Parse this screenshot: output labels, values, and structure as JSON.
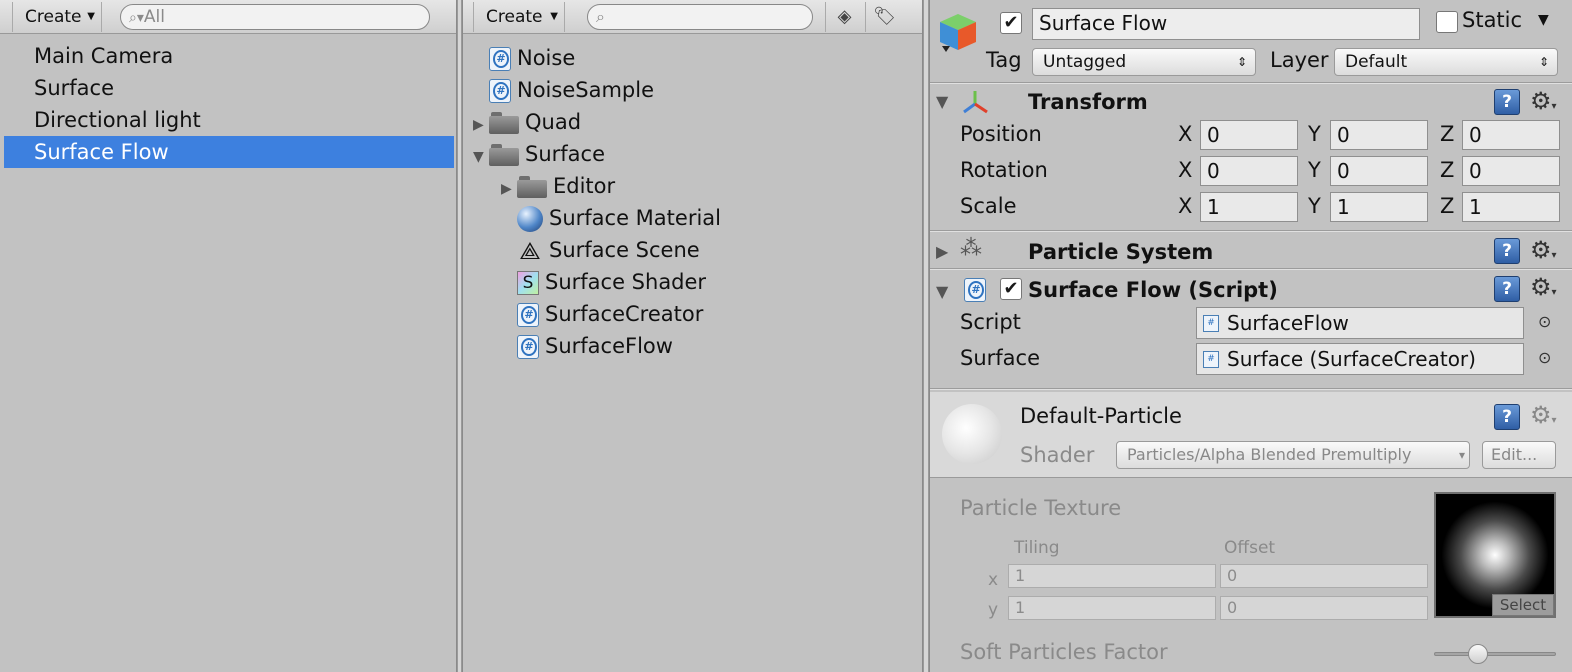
{
  "hierarchy": {
    "create_label": "Create",
    "search_placeholder": "All",
    "items": [
      {
        "label": "Main Camera",
        "selected": false
      },
      {
        "label": "Surface",
        "selected": false
      },
      {
        "label": "Directional light",
        "selected": false
      },
      {
        "label": "Surface Flow",
        "selected": true
      }
    ]
  },
  "project": {
    "create_label": "Create",
    "search_placeholder": "",
    "items": [
      {
        "label": "Noise",
        "icon": "csharp-script-icon",
        "depth": 0,
        "fold": ""
      },
      {
        "label": "NoiseSample",
        "icon": "csharp-script-icon",
        "depth": 0,
        "fold": ""
      },
      {
        "label": "Quad",
        "icon": "folder-icon",
        "depth": 0,
        "fold": "collapsed"
      },
      {
        "label": "Surface",
        "icon": "folder-icon",
        "depth": 0,
        "fold": "expanded"
      },
      {
        "label": "Editor",
        "icon": "folder-icon",
        "depth": 1,
        "fold": "collapsed"
      },
      {
        "label": "Surface Material",
        "icon": "material-icon",
        "depth": 1,
        "fold": ""
      },
      {
        "label": "Surface Scene",
        "icon": "unity-scene-icon",
        "depth": 1,
        "fold": ""
      },
      {
        "label": "Surface Shader",
        "icon": "shader-icon",
        "depth": 1,
        "fold": ""
      },
      {
        "label": "SurfaceCreator",
        "icon": "csharp-script-icon",
        "depth": 1,
        "fold": ""
      },
      {
        "label": "SurfaceFlow",
        "icon": "csharp-script-icon",
        "depth": 1,
        "fold": ""
      }
    ]
  },
  "inspector": {
    "object_name": "Surface Flow",
    "active": true,
    "static_label": "Static",
    "static_checked": false,
    "tag_label": "Tag",
    "tag_value": "Untagged",
    "layer_label": "Layer",
    "layer_value": "Default",
    "transform": {
      "title": "Transform",
      "rows": [
        {
          "label": "Position",
          "x": "0",
          "y": "0",
          "z": "0"
        },
        {
          "label": "Rotation",
          "x": "0",
          "y": "0",
          "z": "0"
        },
        {
          "label": "Scale",
          "x": "1",
          "y": "1",
          "z": "1"
        }
      ],
      "axis_x": "X",
      "axis_y": "Y",
      "axis_z": "Z"
    },
    "particle_system": {
      "title": "Particle System"
    },
    "script_component": {
      "title": "Surface Flow (Script)",
      "enabled": true,
      "script_label": "Script",
      "script_value": "SurfaceFlow",
      "surface_label": "Surface",
      "surface_value": "Surface (SurfaceCreator)"
    },
    "material": {
      "name": "Default-Particle",
      "shader_label": "Shader",
      "shader_value": "Particles/Alpha Blended Premultiply",
      "edit_label": "Edit...",
      "texture_label": "Particle Texture",
      "tiling_label": "Tiling",
      "offset_label": "Offset",
      "x_label": "x",
      "y_label": "y",
      "tiling_x": "1",
      "tiling_y": "1",
      "offset_x": "0",
      "offset_y": "0",
      "select_label": "Select",
      "soft_particles_label": "Soft Particles Factor"
    }
  }
}
